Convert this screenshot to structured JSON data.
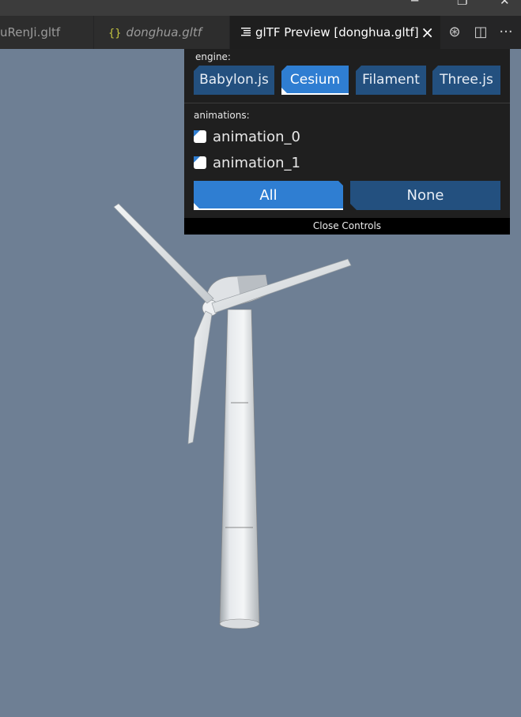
{
  "window": {
    "controls": [
      "minimize-icon",
      "restore-icon",
      "close-icon"
    ]
  },
  "tabs": [
    {
      "label": "uRenJi.gltf",
      "state": "inactive"
    },
    {
      "label": "donghua.gltf",
      "icon": "{}",
      "state": "inactive"
    },
    {
      "label": "glTF Preview [donghua.gltf]",
      "icon": "preview-icon",
      "state": "active",
      "close_icon": "×"
    }
  ],
  "editor_actions": [
    {
      "icon": "compass-icon",
      "glyph": "⊛"
    },
    {
      "icon": "split-editor-icon",
      "glyph": "◫"
    },
    {
      "icon": "more-actions-icon",
      "glyph": "···"
    }
  ],
  "controls": {
    "engine_label": "engine:",
    "engines": [
      "Babylon.js",
      "Cesium",
      "Filament",
      "Three.js"
    ],
    "selected_engine": "Cesium",
    "animations_label": "animations:",
    "animations": [
      {
        "name": "animation_0",
        "checked": true
      },
      {
        "name": "animation_1",
        "checked": true
      }
    ],
    "all_label": "All",
    "none_label": "None",
    "close_label": "Close Controls"
  },
  "colors": {
    "viewport_bg": "#6e7f94",
    "panel_bg": "#1f1f1f",
    "accent_selected": "#2f7ed2",
    "button_default": "#23507f"
  }
}
